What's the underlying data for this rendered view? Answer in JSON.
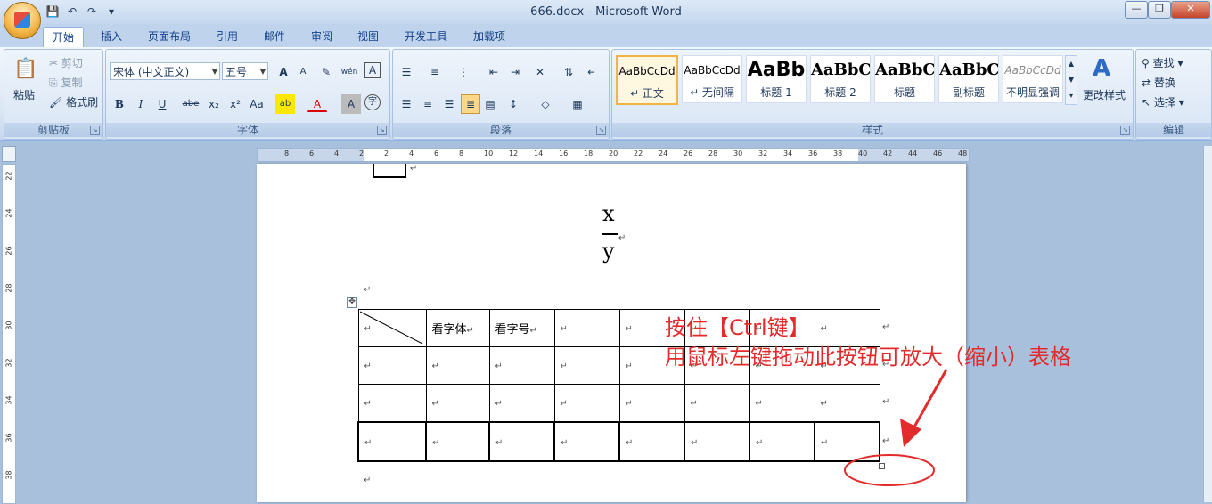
{
  "window": {
    "title": "666.docx - Microsoft Word"
  },
  "qat_icons": [
    "save-icon",
    "undo-icon",
    "redo-icon",
    "customize-icon"
  ],
  "tabs": [
    "开始",
    "插入",
    "页面布局",
    "引用",
    "邮件",
    "审阅",
    "视图",
    "开发工具",
    "加载项"
  ],
  "clipboard": {
    "paste": "粘贴",
    "cut": "剪切",
    "copy": "复制",
    "format_painter": "格式刷",
    "label": "剪贴板"
  },
  "font": {
    "font_name": "宋体 (中文正文)",
    "font_size": "五号",
    "label": "字体",
    "grow": "A",
    "shrink": "A",
    "wen": "wén",
    "bold": "B",
    "italic": "I",
    "underline": "U",
    "strike": "abe",
    "sub": "x₂",
    "sup": "x²",
    "case": "Aa",
    "highlight": "ab",
    "color": "A",
    "char_shade": "A",
    "enclose": "字",
    "clear": "A"
  },
  "paragraph": {
    "label": "段落"
  },
  "styles": {
    "label": "样式",
    "items": [
      {
        "preview": "AaBbCcDd",
        "name": "↵ 正文"
      },
      {
        "preview": "AaBbCcDd",
        "name": "↵ 无间隔"
      },
      {
        "preview": "AaBb",
        "name": "标题 1"
      },
      {
        "preview": "AaBbC",
        "name": "标题 2"
      },
      {
        "preview": "AaBbC",
        "name": "标题"
      },
      {
        "preview": "AaBbC",
        "name": "副标题"
      },
      {
        "preview": "AaBbCcDd",
        "name": "不明显强调"
      }
    ],
    "change": "更改样式"
  },
  "editing": {
    "find": "查找",
    "replace": "替换",
    "select": "选择",
    "label": "编辑"
  },
  "hruler": [
    "8",
    "6",
    "4",
    "2",
    "2",
    "4",
    "6",
    "8",
    "10",
    "12",
    "14",
    "16",
    "18",
    "20",
    "22",
    "24",
    "26",
    "28",
    "30",
    "32",
    "34",
    "36",
    "38",
    "40",
    "42",
    "44",
    "46",
    "48"
  ],
  "vruler": [
    "22",
    "24",
    "26",
    "28",
    "30",
    "32",
    "34",
    "36",
    "38"
  ],
  "doc": {
    "frac_num": "x",
    "frac_den": "y",
    "para_mark": "↵",
    "table": [
      [
        "",
        "看字体",
        "看字号",
        "",
        "",
        "",
        "",
        ""
      ],
      [
        "",
        "",
        "",
        "",
        "",
        "",
        "",
        ""
      ],
      [
        "",
        "",
        "",
        "",
        "",
        "",
        "",
        ""
      ],
      [
        "",
        "",
        "",
        "",
        "",
        "",
        "",
        ""
      ]
    ]
  },
  "annotation": {
    "line1": "按住【Ctrl键】",
    "line2": "用鼠标左键拖动此按钮可放大（缩小）表格",
    "color": "#e32b2b"
  }
}
